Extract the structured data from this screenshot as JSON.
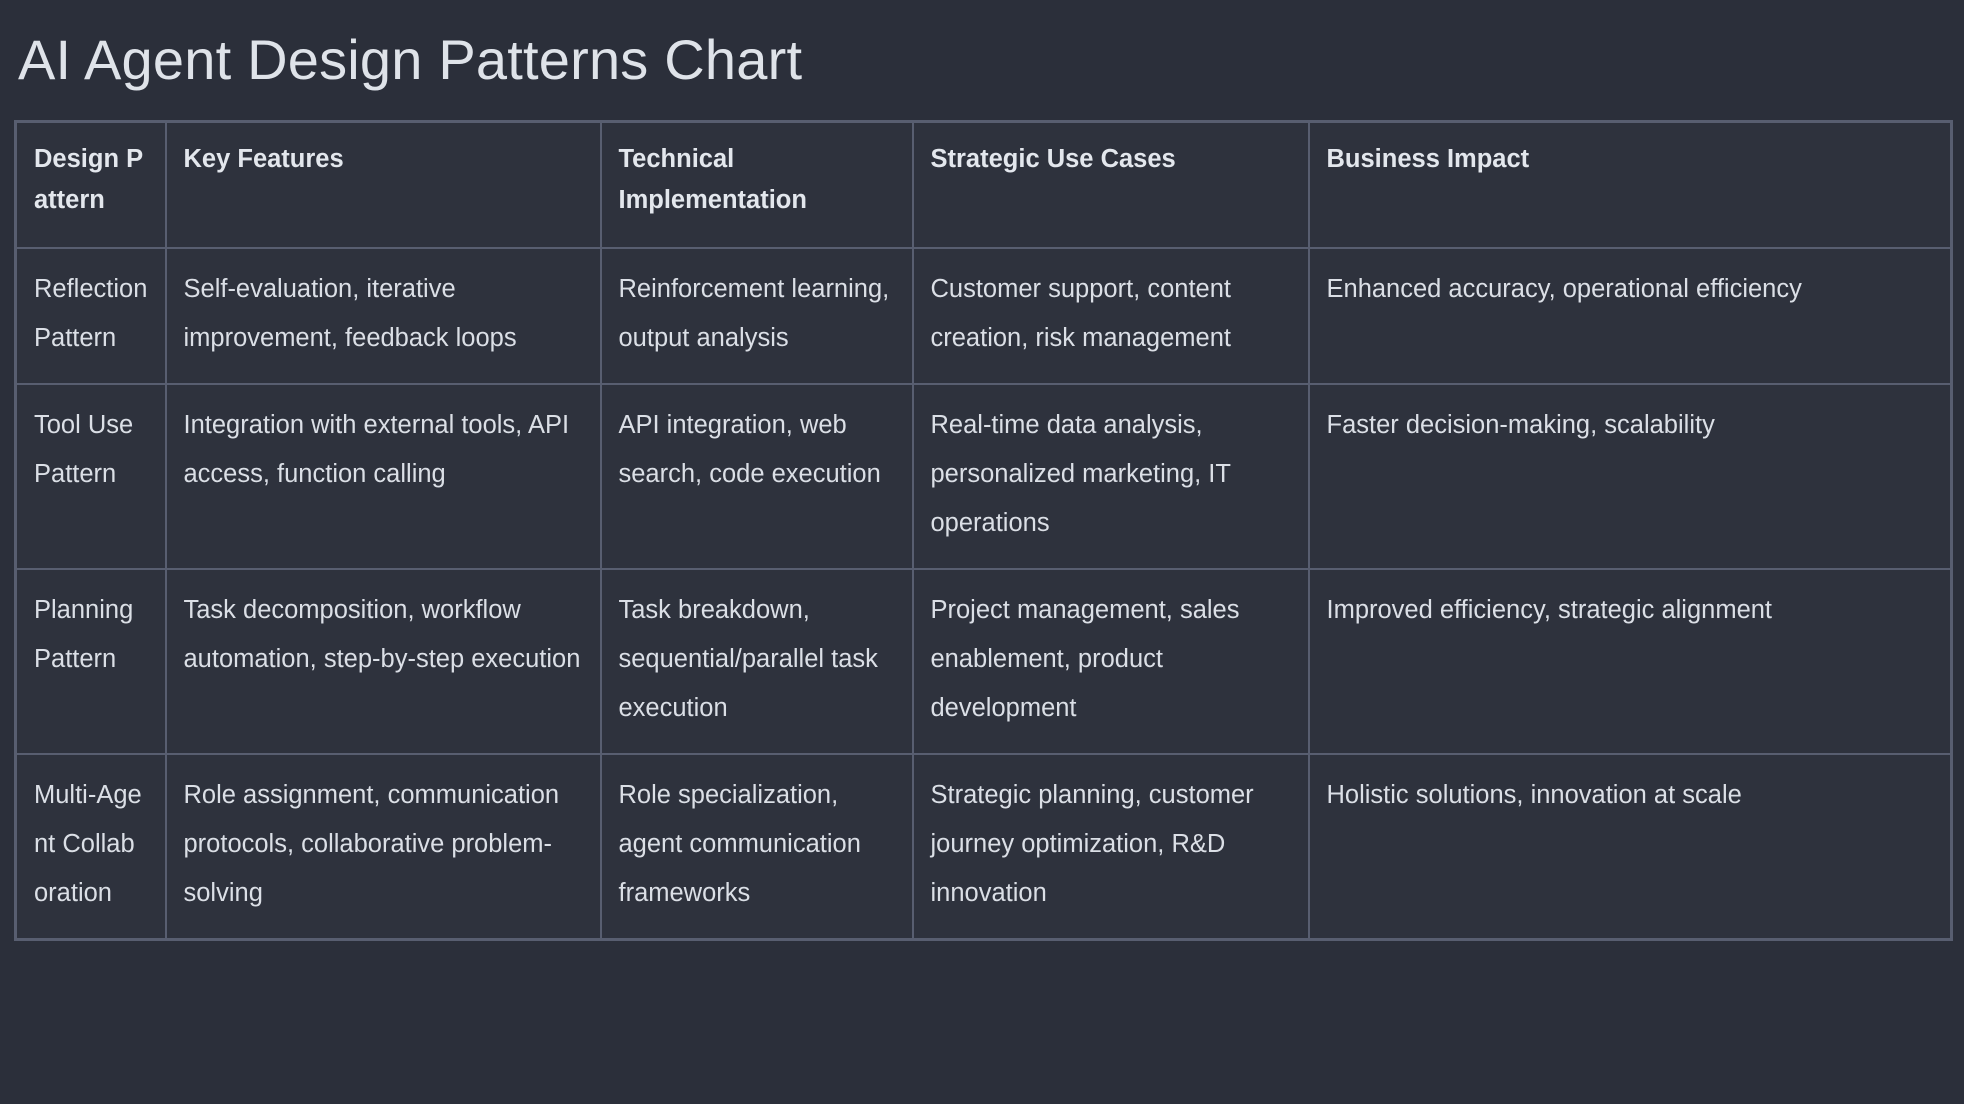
{
  "page": {
    "title": "AI Agent Design Patterns Chart",
    "background_color": "#2b2f3a",
    "text_color": "#dce0e6",
    "border_color": "#585e70"
  },
  "chart_data": {
    "type": "table",
    "title": "AI Agent Design Patterns Chart",
    "columns": [
      "Design Pattern",
      "Key Features",
      "Technical Implementation",
      "Strategic Use Cases",
      "Business Impact"
    ],
    "rows": [
      {
        "pattern": "Reflection Pattern",
        "key_features": "Self-evaluation, iterative improvement, feedback loops",
        "technical_implementation": "Reinforcement learning, output analysis",
        "strategic_use_cases": "Customer support, content creation, risk management",
        "business_impact": "Enhanced accuracy, operational efficiency"
      },
      {
        "pattern": "Tool Use Pattern",
        "key_features": "Integration with external tools, API access, function calling",
        "technical_implementation": "API integration, web search, code execution",
        "strategic_use_cases": "Real-time data analysis, personalized marketing, IT operations",
        "business_impact": "Faster decision-making, scalability"
      },
      {
        "pattern": "Planning Pattern",
        "key_features": "Task decomposition, workflow automation, step-by-step execution",
        "technical_implementation": "Task breakdown, sequential/parallel task execution",
        "strategic_use_cases": "Project management, sales enablement, product development",
        "business_impact": "Improved efficiency, strategic alignment"
      },
      {
        "pattern": "Multi-Agent Collaboration",
        "key_features": "Role assignment, communication protocols, collaborative problem-solving",
        "technical_implementation": "Role specialization, agent communication frameworks",
        "strategic_use_cases": "Strategic planning, customer journey optimization, R&D innovation",
        "business_impact": "Holistic solutions, innovation at scale"
      }
    ]
  }
}
